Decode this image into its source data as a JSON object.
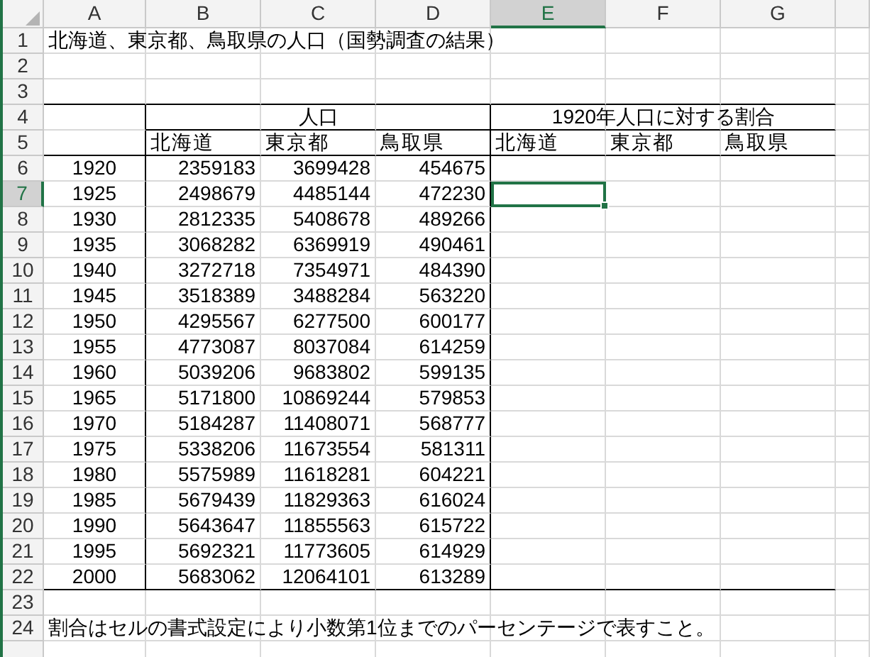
{
  "columns": [
    {
      "label": "A",
      "selected": false
    },
    {
      "label": "B",
      "selected": false
    },
    {
      "label": "C",
      "selected": false
    },
    {
      "label": "D",
      "selected": false
    },
    {
      "label": "E",
      "selected": true
    },
    {
      "label": "F",
      "selected": false
    },
    {
      "label": "G",
      "selected": false
    }
  ],
  "row_headers": [
    {
      "label": "1",
      "selected": false
    },
    {
      "label": "2",
      "selected": false
    },
    {
      "label": "3",
      "selected": false
    },
    {
      "label": "4",
      "selected": false
    },
    {
      "label": "5",
      "selected": false
    },
    {
      "label": "6",
      "selected": false
    },
    {
      "label": "7",
      "selected": true
    },
    {
      "label": "8",
      "selected": false
    },
    {
      "label": "9",
      "selected": false
    },
    {
      "label": "10",
      "selected": false
    },
    {
      "label": "11",
      "selected": false
    },
    {
      "label": "12",
      "selected": false
    },
    {
      "label": "13",
      "selected": false
    },
    {
      "label": "14",
      "selected": false
    },
    {
      "label": "15",
      "selected": false
    },
    {
      "label": "16",
      "selected": false
    },
    {
      "label": "17",
      "selected": false
    },
    {
      "label": "18",
      "selected": false
    },
    {
      "label": "19",
      "selected": false
    },
    {
      "label": "20",
      "selected": false
    },
    {
      "label": "21",
      "selected": false
    },
    {
      "label": "22",
      "selected": false
    },
    {
      "label": "23",
      "selected": false
    },
    {
      "label": "24",
      "selected": false
    }
  ],
  "title": "北海道、東京都、鳥取県の人口（国勢調査の結果）",
  "group_headers": [
    "人口",
    "1920年人口に対する割合"
  ],
  "population_subheaders": [
    "北海道",
    "東京都",
    "鳥取県"
  ],
  "ratio_subheaders": [
    "北海道",
    "東京都",
    "鳥取県"
  ],
  "data_rows": [
    {
      "year": "1920",
      "values": [
        "2359183",
        "3699428",
        "454675"
      ]
    },
    {
      "year": "1925",
      "values": [
        "2498679",
        "4485144",
        "472230"
      ]
    },
    {
      "year": "1930",
      "values": [
        "2812335",
        "5408678",
        "489266"
      ]
    },
    {
      "year": "1935",
      "values": [
        "3068282",
        "6369919",
        "490461"
      ]
    },
    {
      "year": "1940",
      "values": [
        "3272718",
        "7354971",
        "484390"
      ]
    },
    {
      "year": "1945",
      "values": [
        "3518389",
        "3488284",
        "563220"
      ]
    },
    {
      "year": "1950",
      "values": [
        "4295567",
        "6277500",
        "600177"
      ]
    },
    {
      "year": "1955",
      "values": [
        "4773087",
        "8037084",
        "614259"
      ]
    },
    {
      "year": "1960",
      "values": [
        "5039206",
        "9683802",
        "599135"
      ]
    },
    {
      "year": "1965",
      "values": [
        "5171800",
        "10869244",
        "579853"
      ]
    },
    {
      "year": "1970",
      "values": [
        "5184287",
        "11408071",
        "568777"
      ]
    },
    {
      "year": "1975",
      "values": [
        "5338206",
        "11673554",
        "581311"
      ]
    },
    {
      "year": "1980",
      "values": [
        "5575989",
        "11618281",
        "604221"
      ]
    },
    {
      "year": "1985",
      "values": [
        "5679439",
        "11829363",
        "616024"
      ]
    },
    {
      "year": "1990",
      "values": [
        "5643647",
        "11855563",
        "615722"
      ]
    },
    {
      "year": "1995",
      "values": [
        "5692321",
        "11773605",
        "614929"
      ]
    },
    {
      "year": "2000",
      "values": [
        "5683062",
        "12064101",
        "613289"
      ]
    }
  ],
  "note": "割合はセルの書式設定により小数第1位までのパーセンテージで表すこと。"
}
